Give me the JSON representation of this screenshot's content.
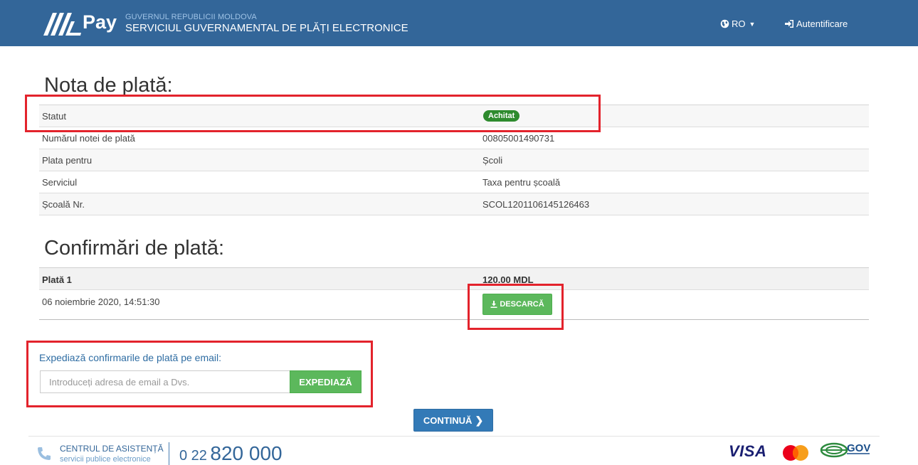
{
  "header": {
    "logo_text": "Pay",
    "gov_small": "GUVERNUL REPUBLICII MOLDOVA",
    "gov_big": "SERVICIUL GUVERNAMENTAL DE PLĂȚI ELECTRONICE",
    "language": "RO",
    "login_label": "Autentificare"
  },
  "nota": {
    "title": "Nota de plată:",
    "rows": [
      {
        "label": "Statut",
        "value": "Achitat"
      },
      {
        "label": "Numărul notei de plată",
        "value": "00805001490731"
      },
      {
        "label": "Plata pentru",
        "value": "Școli"
      },
      {
        "label": "Serviciul",
        "value": "Taxa pentru școală"
      },
      {
        "label": "Școală Nr.",
        "value": "SCOL1201106145126463"
      }
    ]
  },
  "confirmari": {
    "title": "Confirmări de plată:",
    "payment_label": "Plată 1",
    "amount": "120.00 MDL",
    "datetime": "06 noiembrie 2020, 14:51:30",
    "download_label": "DESCARCĂ"
  },
  "email": {
    "title": "Expediază confirmarile de plată pe email:",
    "placeholder": "Introduceți adresa de email a Dvs.",
    "value": "",
    "send_label": "EXPEDIAZĂ"
  },
  "continue_label": "CONTINUĂ",
  "footer": {
    "support_title": "CENTRUL DE ASISTENȚĂ",
    "support_sub": "servicii publice electronice",
    "phone_prefix": "0 22",
    "phone_main": "820 000",
    "visa": "VISA",
    "gov": "GOV"
  },
  "colors": {
    "header_bg": "#336699",
    "success": "#5cb85c",
    "primary": "#337ab7",
    "highlight": "#e3232c"
  }
}
